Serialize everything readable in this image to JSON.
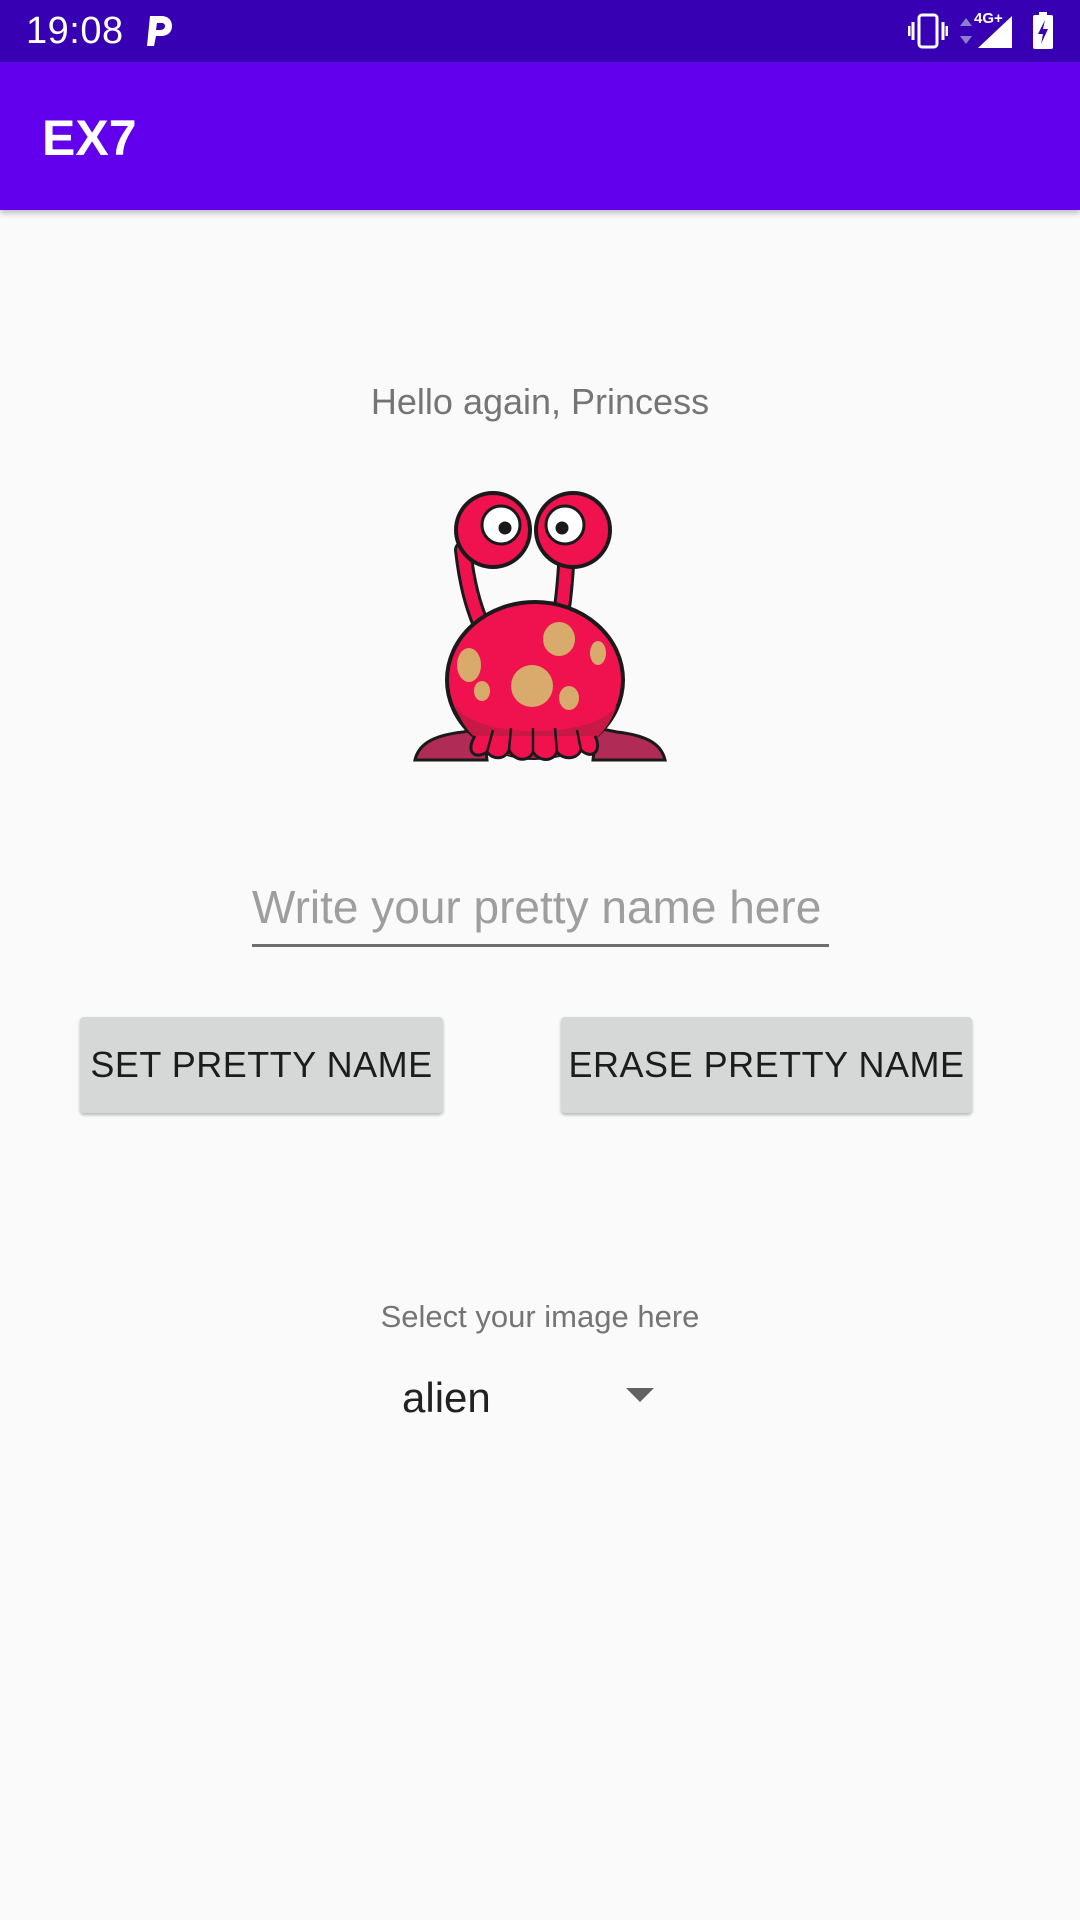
{
  "status_bar": {
    "time": "19:08",
    "network_badge": "4G+",
    "icons": [
      "p-app-icon",
      "vibrate-icon",
      "data-arrows-icon",
      "signal-icon",
      "battery-charging-icon"
    ]
  },
  "app_bar": {
    "title": "EX7",
    "color": "#6200ee",
    "status_color": "#3700b3"
  },
  "main": {
    "greeting": "Hello again, Princess",
    "image_icon": "alien-icon",
    "name_input": {
      "placeholder": "Write your pretty name here",
      "value": ""
    },
    "buttons": {
      "set_label": "SET PRETTY NAME",
      "erase_label": "ERASE PRETTY NAME"
    },
    "select_label": "Select your image here",
    "spinner": {
      "selected": "alien"
    }
  }
}
